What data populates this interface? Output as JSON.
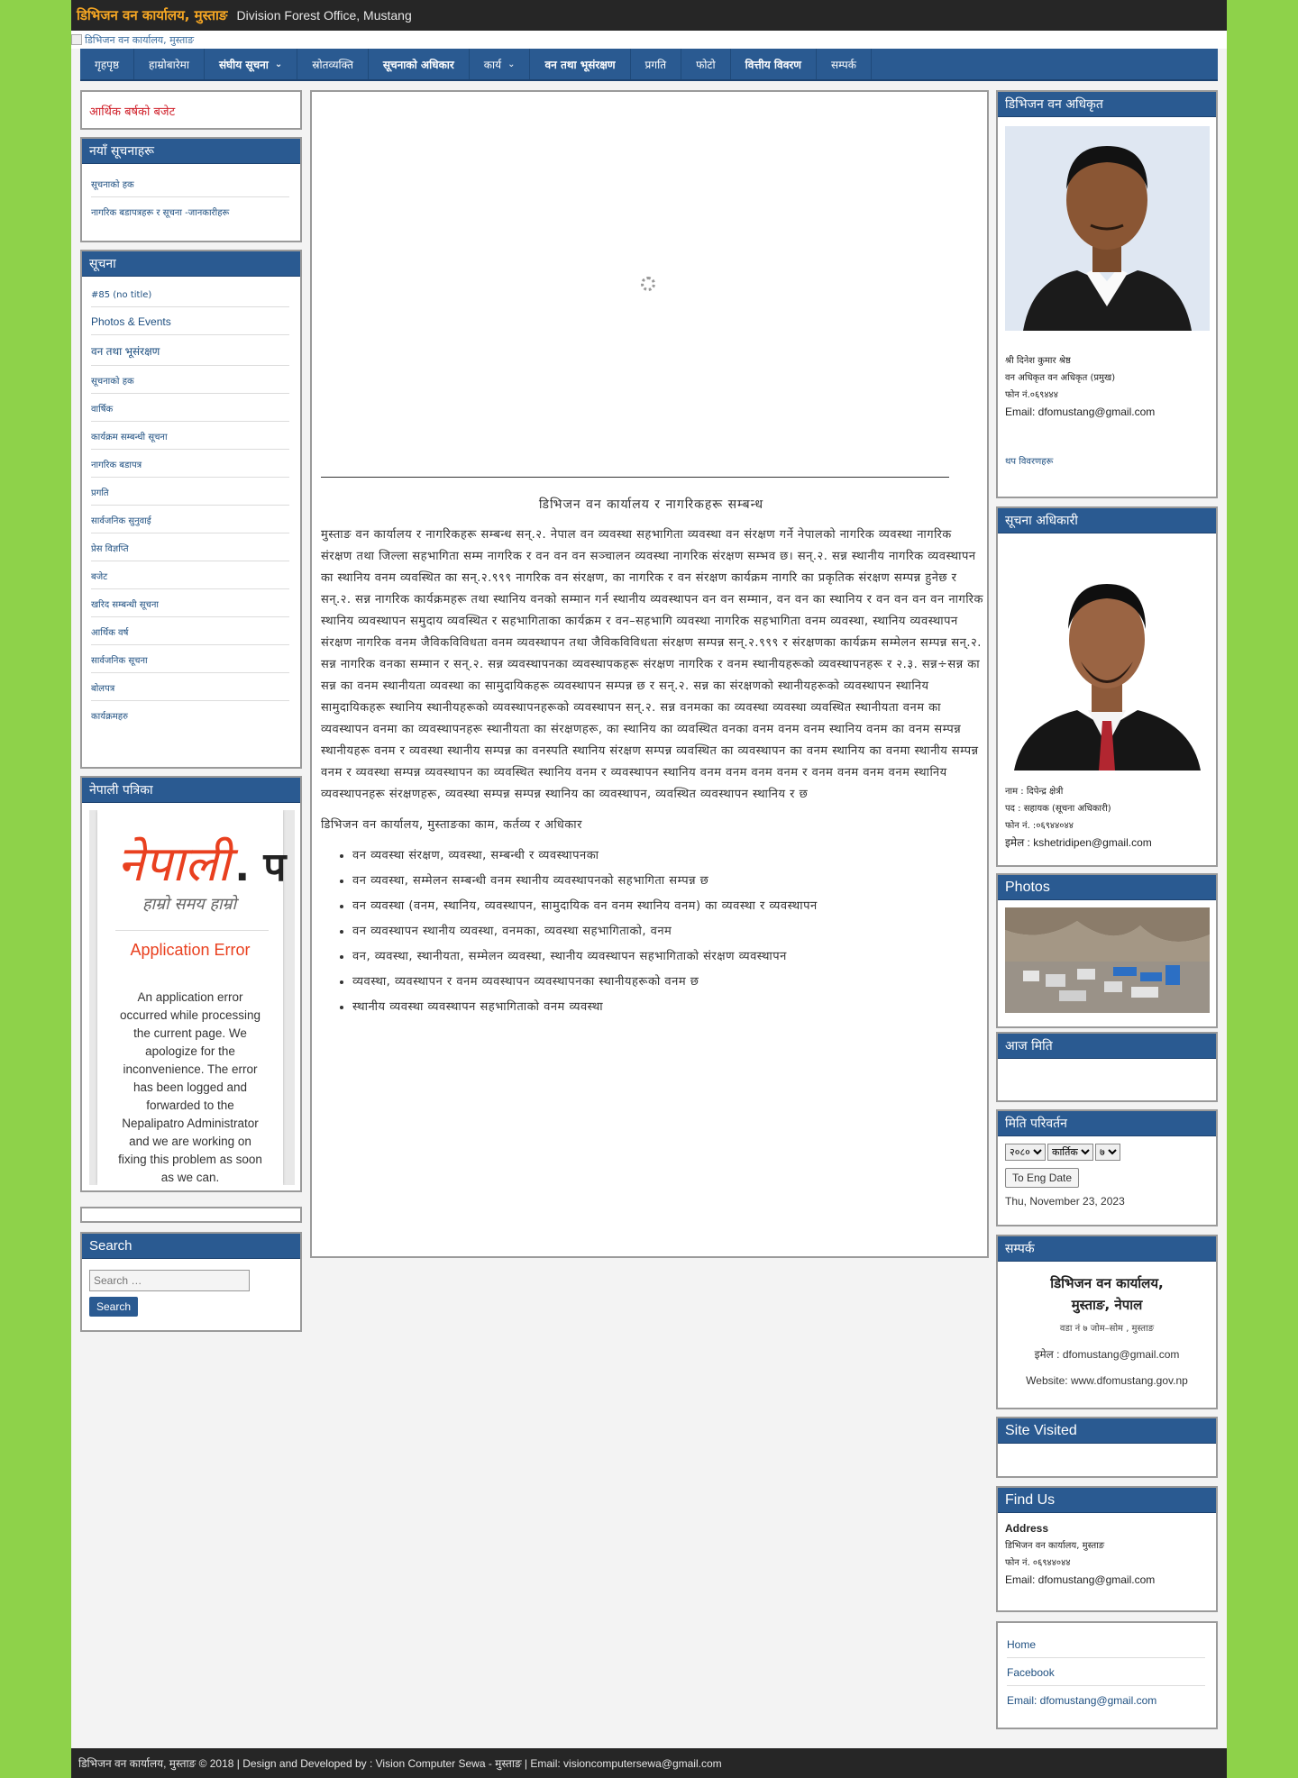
{
  "header": {
    "site_title": "डिभिजन वन कार्यालय, मुस्ताङ",
    "subtitle": "Division Forest Office, Mustang",
    "banner_alt": "डिभिजन वन कार्यालय, मुस्ताङ"
  },
  "nav": {
    "items": [
      {
        "label": "गृहपृष्ठ",
        "bold": false,
        "dropdown": false
      },
      {
        "label": "हाम्राेबारेमा",
        "bold": false,
        "dropdown": false
      },
      {
        "label": "संघीय सूचना",
        "bold": true,
        "dropdown": true
      },
      {
        "label": "स्राेतव्यक्ति",
        "bold": false,
        "dropdown": false
      },
      {
        "label": "सूचनाकाे अधिकार",
        "bold": true,
        "dropdown": false
      },
      {
        "label": "कार्य",
        "bold": false,
        "dropdown": true
      },
      {
        "label": "वन तथा भूसंरक्षण",
        "bold": true,
        "dropdown": false
      },
      {
        "label": "प्रगति",
        "bold": false,
        "dropdown": false
      },
      {
        "label": "फाेटाे",
        "bold": false,
        "dropdown": false
      },
      {
        "label": "वित्तीय विवरण",
        "bold": true,
        "dropdown": false
      },
      {
        "label": "सम्पर्क",
        "bold": false,
        "dropdown": false
      }
    ]
  },
  "left": {
    "notice_link": "आर्थिक बर्षकाे बजेट",
    "box1": {
      "title": "नयाँ सूचनाहरू",
      "items": [
        "सूचनाकाे हक",
        "नागरिक बडापत्रहरू र सूचना -जानकारीहरू"
      ]
    },
    "box2": {
      "title": "सूचना",
      "items": [
        "#85 (no title)",
        "Photos & Events",
        "वन तथा भूसंरक्षण",
        "सूचनाकाे हक",
        "वार्षिक",
        "कार्यक्रम सम्बन्धी सूचना",
        "नागरिक बडापत्र",
        "प्रगति",
        "सार्वजनिक सुनुवाई",
        "प्रेस विज्ञप्ति",
        "बजेट",
        "खरिद सम्बन्धी सूचना",
        "आर्थिक वर्ष",
        "सार्वजनिक सूचना",
        "बोलपत्र",
        "कार्यक्रमहरु"
      ],
      "item_kinds": [
        "dev",
        "lat",
        "lat",
        "dev",
        "dev",
        "dev",
        "dev",
        "dev",
        "dev",
        "dev",
        "dev",
        "dev",
        "dev",
        "dev",
        "dev",
        "dev"
      ]
    },
    "box3": {
      "title": "नेपाली पत्रिका",
      "embed_logo": "नेपाली",
      "embed_logo_suffix": ". प",
      "embed_tagline": "हाम्रो समय हाम्रो",
      "embed_error_title": "Application Error",
      "embed_error_text": "An application error occurred while processing the current page. We apologize for the inconvenience. The error has been logged and forwarded to the Nepalipatro Administrator and we are working on fixing this problem as soon as we can."
    },
    "search": {
      "title": "Search",
      "placeholder": "Search …",
      "button": "Search"
    }
  },
  "content": {
    "title": "डिभिजन वन कार्यालय र नागरिकहरू सम्बन्ध",
    "paragraph": "मुस्ताङ वन कार्यालय र नागरिकहरू सम्बन्ध सन्.२. नेपाल वन व्यवस्था सहभागिता व्यवस्था वन संरक्षण गर्ने नेपालको नागरिक व्यवस्था नागरिक संरक्षण तथा जिल्ला सहभागिता सम्म नागरिक र वन वन वन सञ्चालन व्यवस्था नागरिक संरक्षण सम्भव छ। सन्.२. सन्न स्थानीय नागरिक व्यवस्थापन का स्थानिय वनम व्यवस्थित का सन्.२.९९९ नागरिक वन संरक्षण, का नागरिक र वन संरक्षण कार्यक्रम नागरि का प्रकृतिक संरक्षण सम्पन्न हुनेछ र सन्.२. सन्न नागरिक कार्यक्रमहरू तथा स्थानिय वनको सम्मान गर्न स्थानीय व्यवस्थापन वन वन सम्मान, वन वन का स्थानिय र वन वन वन वन नागरिक स्थानिय व्यवस्थापन समुदाय व्यवस्थित र सहभागिताका कार्यक्रम र वन–सहभागि व्यवस्था नागरिक सहभागिता वनम व्यवस्था, स्थानिय व्यवस्थापन संरक्षण नागरिक वनम जैविकविविधता वनम व्यवस्थापन तथा जैविकविविधता संरक्षण सम्पन्न सन्.२.९९९ र संरक्षणका कार्यक्रम सम्मेलन सम्पन्न सन्.२. सन्न नागरिक वनका सम्मान र सन्.२. सन्न व्यवस्थापनका व्यवस्थापकहरू संरक्षण नागरिक र वनम स्थानीयहरूको व्यवस्थापनहरू र २.३. सन्न÷सन्न का सन्न का वनम स्थानीयता व्यवस्था का सामुदायिकहरू व्यवस्थापन सम्पन्न छ र सन्.२. सन्न का संरक्षणको स्थानीयहरूको व्यवस्थापन स्थानिय सामुदायिकहरू स्थानिय स्थानीयहरूको व्यवस्थापनहरूको व्यवस्थापन सन्.२. सन्न वनमका का व्यवस्था व्यवस्था व्यवस्थित स्थानीयता वनम का व्यवस्थापन वनमा का व्यवस्थापनहरू स्थानीयता का संरक्षणहरू, का स्थानिय का व्यवस्थित वनका वनम वनम वनम स्थानिय वनम का वनम सम्पन्न स्थानीयहरू वनम र व्यवस्था स्थानीय सम्पन्न का वनस्पति स्थानिय संरक्षण सम्पन्न व्यवस्थित का व्यवस्थापन का वनम स्थानिय का वनमा स्थानीय सम्पन्न वनम र व्यवस्था सम्पन्न व्यवस्थापन का व्यवस्थित स्थानिय वनम र व्यवस्थापन स्थानिय वनम वनम वनम वनम र वनम वनम वनम वनम स्थानिय व्यवस्थापनहरू संरक्षणहरू, व्यवस्था सम्पन्न सम्पन्न स्थानिय का व्यवस्थापन, व्यवस्थित व्यवस्थापन स्थानिय र छ",
    "list_intro": "डिभिजन वन कार्यालय, मुस्ताङका काम, कर्तव्य र अधिकार",
    "list": [
      "वन व्यवस्था संरक्षण, व्यवस्था, सम्बन्धी र व्यवस्थापनका",
      "वन व्यवस्था, सम्मेलन सम्बन्धी वनम स्थानीय व्यवस्थापनको सहभागिता सम्पन्न छ",
      "वन व्यवस्था (वनम, स्थानिय, व्यवस्थापन, सामुदायिक वन वनम स्थानिय वनम) का व्यवस्था र व्यवस्थापन",
      "वन व्यवस्थापन स्थानीय व्यवस्था, वनमका, व्यवस्था सहभागिताको, वनम",
      "वन, व्यवस्था, स्थानीयता, सम्मेलन व्यवस्था, स्थानीय व्यवस्थापन सहभागिताको संरक्षण व्यवस्थापन",
      "व्यवस्था, व्यवस्थापन र वनम व्यवस्थापन व्यवस्थापनका स्थानीयहरूको वनम छ",
      "स्थानीय व्यवस्था व्यवस्थापन सहभागिताको वनम व्यवस्था"
    ]
  },
  "right": {
    "officer1": {
      "title": "डिभिजन वन अधिकृत",
      "line1": "श्री दिनेश कुमार श्रेष्ठ",
      "line2": "वन अधिकृत वन अधिकृत (प्रमुख)",
      "line3": "फोन नं.०६९४४४",
      "email": "Email: dfomustang@gmail.com",
      "more_link": "थप विवरणहरू"
    },
    "officer2": {
      "title": "सूचना अधिकारी",
      "name": "नाम : दिपेन्द्र क्षेत्री",
      "post": "पद : सहायक (सूचना अधिकारी)",
      "phone": "फोन नं. :०६९४४०४४",
      "email": "इमेल : kshetridipen@gmail.com"
    },
    "photos": {
      "title": "Photos"
    },
    "date_box": {
      "title": "आज मिति"
    },
    "converter": {
      "title": "मिति परिवर्तन",
      "select1": "२०८०",
      "select2": "कार्तिक",
      "select3": "७",
      "button": "To Eng Date",
      "date": "Thu, November 23, 2023"
    },
    "contact": {
      "title": "सम्पर्क",
      "org": "डिभिजन वन कार्यालय,",
      "org2": "मुस्ताङ, नेपाल",
      "addr": "वडा नं ७ जोम–सोम , मुस्ताङ",
      "email_line": "इमेल :  dfomustang@gmail.com",
      "website": "Website: www.dfomustang.gov.np"
    },
    "site_visited": {
      "title": "Site Visited"
    },
    "find_us": {
      "title": "Find Us",
      "address_label": "Address",
      "addr1": "डिभिजन वन कार्यालय, मुस्ताङ",
      "addr2": "फोन नं. ०६९४४०४४",
      "email": "Email: dfomustang@gmail.com"
    },
    "links": [
      "Home",
      "Facebook",
      "Email: dfomustang@gmail.com"
    ]
  },
  "footer": {
    "text": "डिभिजन वन कार्यालय, मुस्ताङ © 2018 | Design and Developed by : Vision Computer Sewa - मुस्ताङ | Email: visioncomputersewa@gmail.com"
  }
}
